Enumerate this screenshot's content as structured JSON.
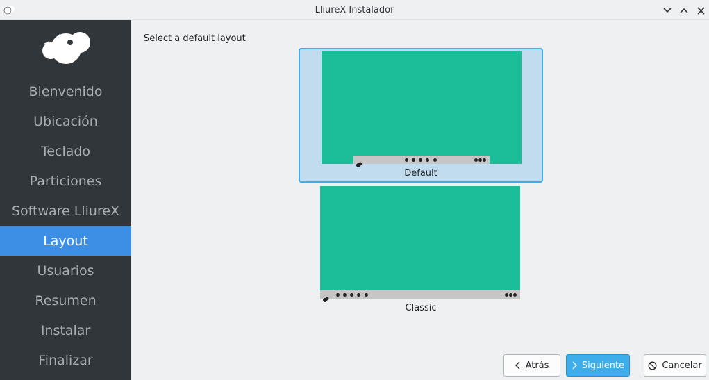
{
  "window": {
    "title": "LliureX Instalador"
  },
  "sidebar": {
    "items": [
      {
        "label": "Bienvenido",
        "active": false
      },
      {
        "label": "Ubicación",
        "active": false
      },
      {
        "label": "Teclado",
        "active": false
      },
      {
        "label": "Particiones",
        "active": false
      },
      {
        "label": "Software LliureX",
        "active": false
      },
      {
        "label": "Layout",
        "active": true
      },
      {
        "label": "Usuarios",
        "active": false
      },
      {
        "label": "Resumen",
        "active": false
      },
      {
        "label": "Instalar",
        "active": false
      },
      {
        "label": "Finalizar",
        "active": false
      }
    ]
  },
  "main": {
    "section_label": "Select a default layout",
    "layouts": [
      {
        "label": "Default",
        "selected": true
      },
      {
        "label": "Classic",
        "selected": false
      }
    ]
  },
  "footer": {
    "back_label": "Atrás",
    "next_label": "Siguiente",
    "cancel_label": "Cancelar"
  },
  "colors": {
    "sidebar_bg": "#31363b",
    "accent": "#3d8ee5",
    "preview_green": "#1cbe99",
    "selection_bg": "#c2dcef",
    "selection_border": "#3daee9"
  },
  "icons": [
    "app-cloud-icon",
    "minimize-icon",
    "maximize-icon",
    "close-icon",
    "lliurex-logo-icon",
    "chevron-left-icon",
    "chevron-right-icon",
    "cancel-circle-icon"
  ]
}
